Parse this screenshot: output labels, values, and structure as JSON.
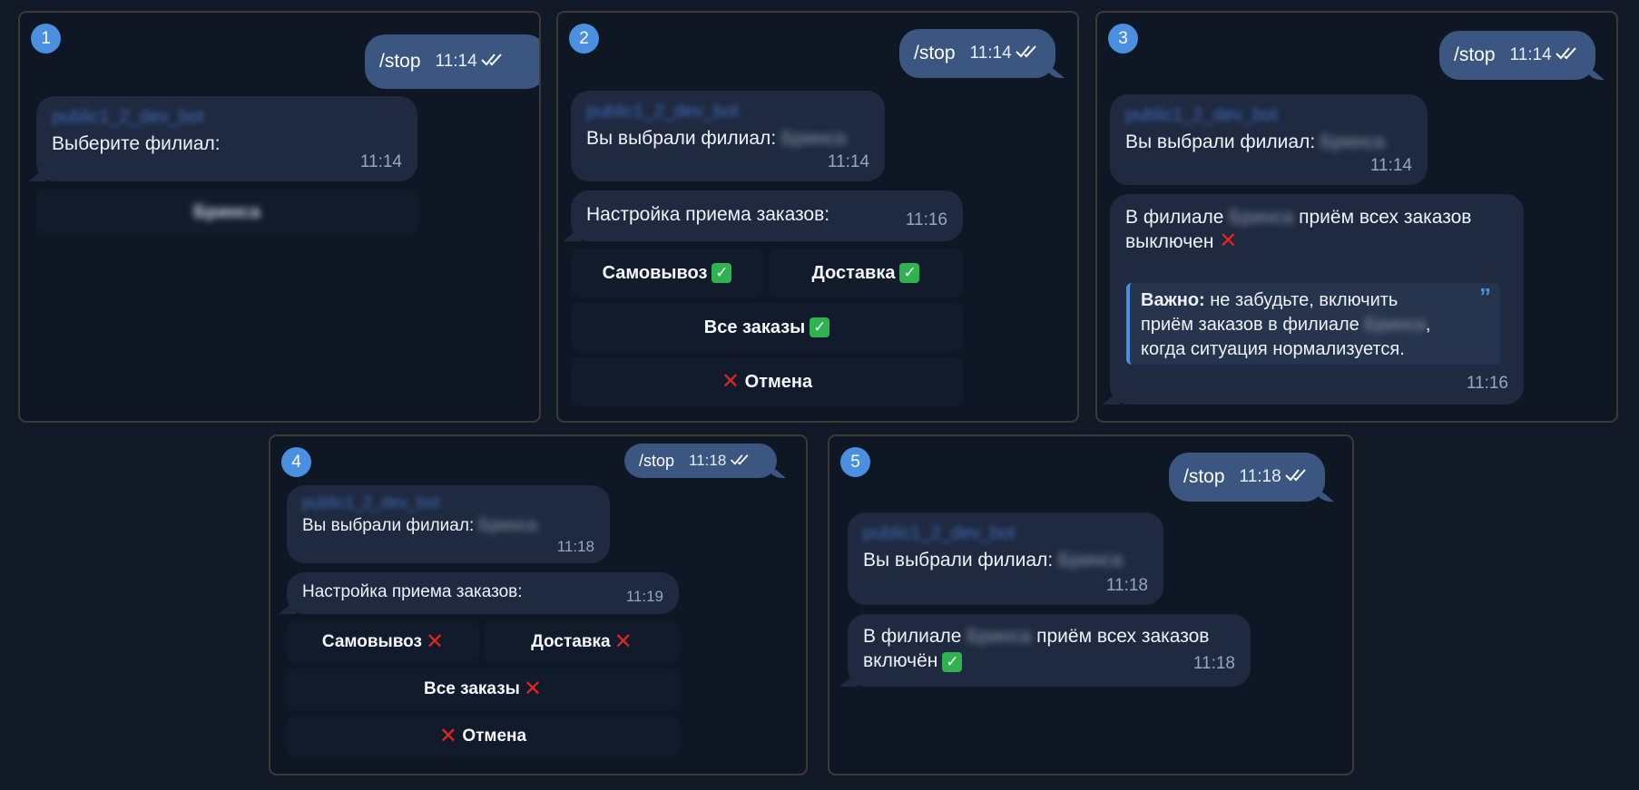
{
  "panels": [
    {
      "step": "1",
      "cmd": "/stop",
      "cmd_time": "11:14",
      "sender": "public1_2_dev_bot",
      "text": "Выберите филиал:",
      "time": "11:14",
      "branch_button": "Бринса"
    },
    {
      "step": "2",
      "cmd": "/stop",
      "cmd_time": "11:14",
      "sender": "public1_2_dev_bot",
      "chosen_text": "Вы выбрали филиал:",
      "branch": "Бринса",
      "chosen_time": "11:14",
      "settings_text": "Настройка приема заказов:",
      "settings_time": "11:16",
      "buttons": {
        "pickup": "Самовывоз",
        "delivery": "Доставка",
        "all": "Все заказы",
        "cancel": "Отмена"
      }
    },
    {
      "step": "3",
      "cmd": "/stop",
      "cmd_time": "11:14",
      "sender": "public1_2_dev_bot",
      "chosen_text": "Вы выбрали филиал:",
      "branch": "Бринса",
      "chosen_time": "11:14",
      "status_pre": "В филиале",
      "status_post": "приём всех заказов",
      "status_line2": "выключен",
      "quote_bold": "Важно:",
      "quote_line1": "не забудьте, включить",
      "quote_line2": "приём заказов в филиале",
      "quote_line3": "когда ситуация нормализуется.",
      "status_time": "11:16"
    },
    {
      "step": "4",
      "cmd": "/stop",
      "cmd_time": "11:18",
      "sender": "public1_2_dev_bot",
      "chosen_text": "Вы выбрали филиал:",
      "branch": "Бринса",
      "chosen_time": "11:18",
      "settings_text": "Настройка приема заказов:",
      "settings_time": "11:19",
      "buttons": {
        "pickup": "Самовывоз",
        "delivery": "Доставка",
        "all": "Все заказы",
        "cancel": "Отмена"
      }
    },
    {
      "step": "5",
      "cmd": "/stop",
      "cmd_time": "11:18",
      "sender": "public1_2_dev_bot",
      "chosen_text": "Вы выбрали филиал:",
      "branch": "Бринса",
      "chosen_time": "11:18",
      "status_pre": "В филиале",
      "status_post": "приём всех заказов",
      "status_line2": "включён",
      "status_time": "11:18"
    }
  ],
  "icons": {
    "check": "✓",
    "cross": "✕",
    "double_tick": "double-check-icon"
  },
  "colors": {
    "accent": "#4a8fe0",
    "outgoing": "#3b5680",
    "incoming": "#1f2a40",
    "ok": "#2fb350",
    "no": "#e0261f"
  }
}
